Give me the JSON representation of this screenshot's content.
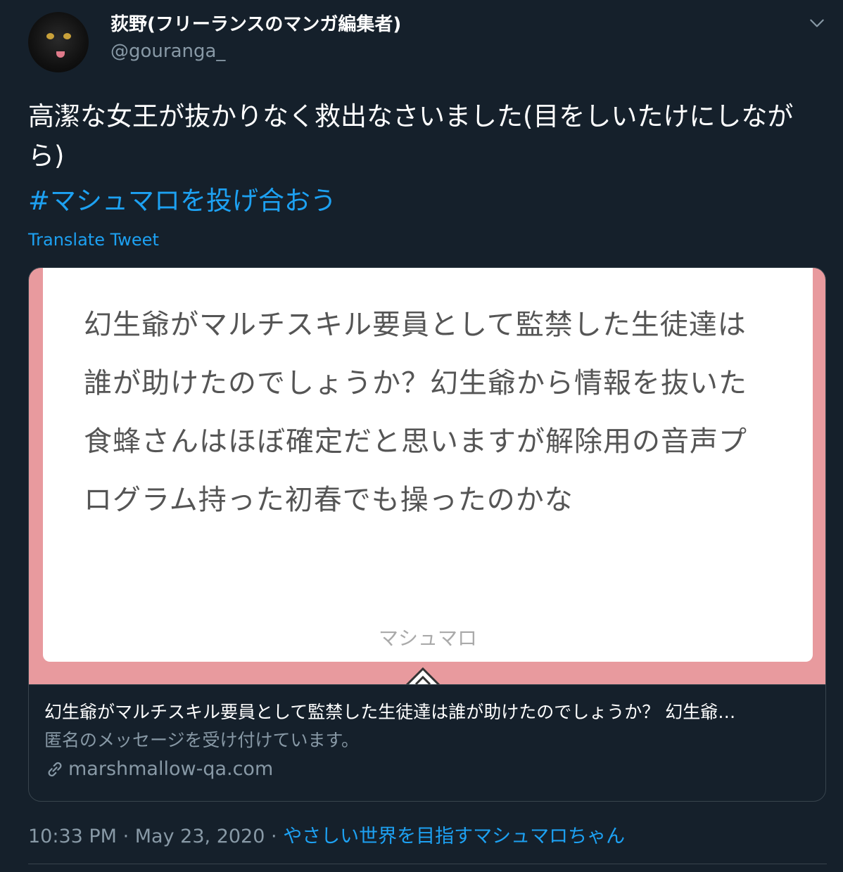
{
  "author": {
    "display_name": "荻野(フリーランスのマンガ編集者)",
    "handle": "@gouranga_",
    "avatar_icon": "cat-avatar"
  },
  "tweet": {
    "text": "高潔な女王が抜かりなく救出なさいました(目をしいたけにしながら)",
    "hashtag": "#マシュマロを投げ合おう",
    "translate_label": "Translate Tweet"
  },
  "card": {
    "image": {
      "question": "幻生爺がマルチスキル要員として監禁した生徒達は誰が助けたのでしょうか？幻生爺から情報を抜いた食蜂さんはほぼ確定だと思いますが解除用の音声プログラム持った初春でも操ったのかな",
      "brand": "マシュマロ"
    },
    "title": "幻生爺がマルチスキル要員として監禁した生徒達は誰が助けたのでしょうか？ 幻生爺…",
    "description": "匿名のメッセージを受け付けています。",
    "domain": "marshmallow-qa.com"
  },
  "meta": {
    "time": "10:33 PM",
    "separator": "·",
    "date": "May 23, 2020",
    "source": "やさしい世界を目指すマシュマロちゃん"
  },
  "colors": {
    "background": "#15202b",
    "accent": "#1da1f2",
    "secondary_text": "#8899a6",
    "card_pink": "#e89a9e"
  }
}
